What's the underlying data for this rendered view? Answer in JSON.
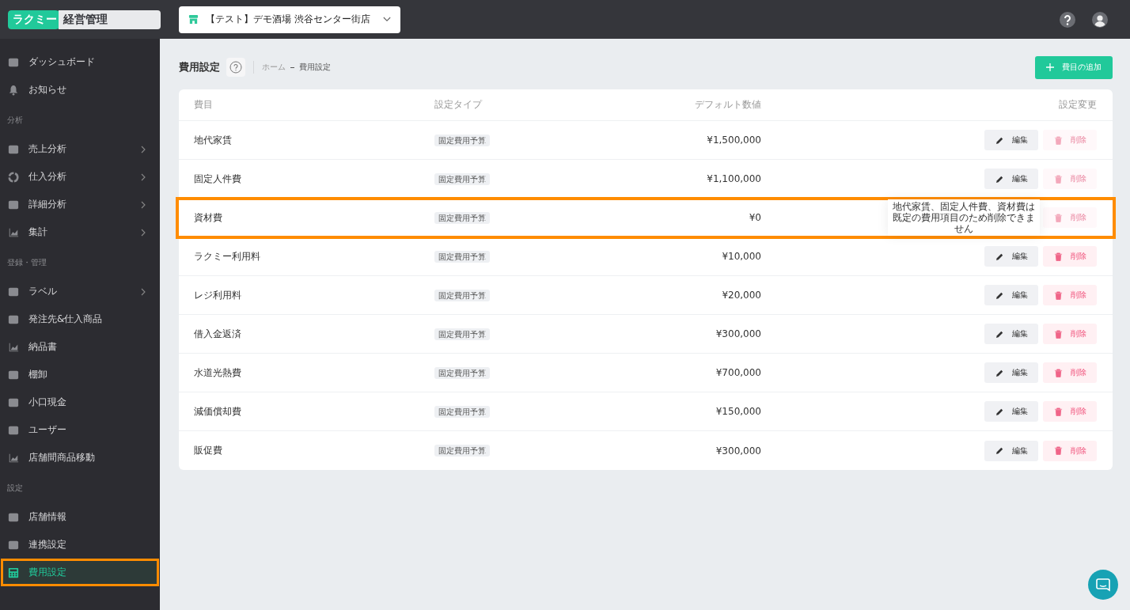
{
  "logo": {
    "brand": "ラクミー",
    "product": "経営管理"
  },
  "store_selector": {
    "value": "【テスト】デモ酒場 渋谷センター街店"
  },
  "sidebar": {
    "sections": [
      {
        "items": [
          {
            "label": "ダッシュボード",
            "selected": false,
            "expandable": false
          },
          {
            "label": "お知らせ",
            "selected": false,
            "expandable": false
          }
        ]
      },
      {
        "title": "分析",
        "items": [
          {
            "label": "売上分析",
            "selected": false,
            "expandable": true
          },
          {
            "label": "仕入分析",
            "selected": false,
            "expandable": true
          },
          {
            "label": "詳細分析",
            "selected": false,
            "expandable": true
          },
          {
            "label": "集計",
            "selected": false,
            "expandable": true
          }
        ]
      },
      {
        "title": "登録・管理",
        "items": [
          {
            "label": "ラベル",
            "selected": false,
            "expandable": true
          },
          {
            "label": "発注先&仕入商品",
            "selected": false,
            "expandable": false
          },
          {
            "label": "納品書",
            "selected": false,
            "expandable": false
          },
          {
            "label": "棚卸",
            "selected": false,
            "expandable": false
          },
          {
            "label": "小口現金",
            "selected": false,
            "expandable": false
          },
          {
            "label": "ユーザー",
            "selected": false,
            "expandable": false
          },
          {
            "label": "店舗間商品移動",
            "selected": false,
            "expandable": false
          }
        ]
      },
      {
        "title": "設定",
        "items": [
          {
            "label": "店舗情報",
            "selected": false,
            "expandable": false
          },
          {
            "label": "連携設定",
            "selected": false,
            "expandable": false
          },
          {
            "label": "費用設定",
            "selected": true,
            "expandable": false,
            "highlighted": true
          }
        ]
      }
    ]
  },
  "page": {
    "title": "費用設定",
    "breadcrumb": [
      "ホーム",
      "費用設定"
    ],
    "add_button": "費目の追加"
  },
  "table": {
    "columns": [
      "費目",
      "設定タイプ",
      "デフォルト数値",
      "設定変更"
    ],
    "rows": [
      {
        "name": "地代家賃",
        "type": "固定費用予算",
        "value": "¥1,500,000",
        "edit": "編集",
        "delete": "削除",
        "delete_disabled": true,
        "highlighted": false
      },
      {
        "name": "固定人件費",
        "type": "固定費用予算",
        "value": "¥1,100,000",
        "edit": "編集",
        "delete": "削除",
        "delete_disabled": true,
        "highlighted": false
      },
      {
        "name": "資材費",
        "type": "固定費用予算",
        "value": "¥0",
        "delete": "削除",
        "delete_disabled": true,
        "highlighted": true,
        "tooltip": "地代家賃、固定人件費、資材費は既定の費用項目のため削除できません"
      },
      {
        "name": "ラクミー利用料",
        "type": "固定費用予算",
        "value": "¥10,000",
        "edit": "編集",
        "delete": "削除",
        "delete_disabled": false,
        "highlighted": false
      },
      {
        "name": "レジ利用料",
        "type": "固定費用予算",
        "value": "¥20,000",
        "edit": "編集",
        "delete": "削除",
        "delete_disabled": false,
        "highlighted": false
      },
      {
        "name": "借入金返済",
        "type": "固定費用予算",
        "value": "¥300,000",
        "edit": "編集",
        "delete": "削除",
        "delete_disabled": false,
        "highlighted": false
      },
      {
        "name": "水道光熱費",
        "type": "固定費用予算",
        "value": "¥700,000",
        "edit": "編集",
        "delete": "削除",
        "delete_disabled": false,
        "highlighted": false
      },
      {
        "name": "減価償却費",
        "type": "固定費用予算",
        "value": "¥150,000",
        "edit": "編集",
        "delete": "削除",
        "delete_disabled": false,
        "highlighted": false
      },
      {
        "name": "販促費",
        "type": "固定費用予算",
        "value": "¥300,000",
        "edit": "編集",
        "delete": "削除",
        "delete_disabled": false,
        "highlighted": false
      }
    ]
  }
}
